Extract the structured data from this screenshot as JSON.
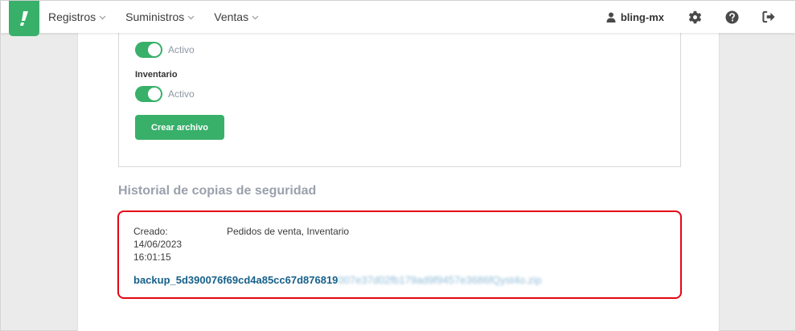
{
  "nav": {
    "items": [
      {
        "label": "Registros"
      },
      {
        "label": "Suministros"
      },
      {
        "label": "Ventas"
      }
    ]
  },
  "user": {
    "name": "bling-mx"
  },
  "form": {
    "toggle_1_label": "Activo",
    "inventory_label": "Inventario",
    "toggle_2_label": "Activo",
    "create_button": "Crear archivo"
  },
  "history": {
    "title": "Historial de copias de seguridad",
    "created_label": "Creado:",
    "date": "14/06/2023",
    "time": "16:01:15",
    "modules": "Pedidos de venta, Inventario",
    "file_visible": "backup_5d390076f69cd4a85cc67d876819",
    "file_blurred": "007e37d02fb179ad9f9457e3686fQyst4o.zip"
  },
  "colors": {
    "brand_green": "#38b06a",
    "highlight_red": "#e30613",
    "link_blue": "#16608a"
  }
}
